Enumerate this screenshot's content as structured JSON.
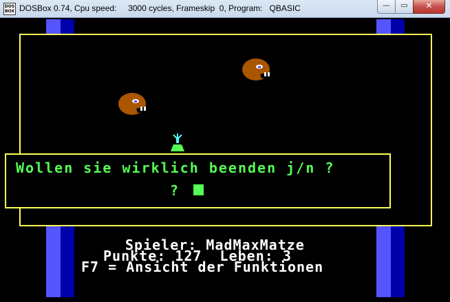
{
  "window": {
    "icon_text": "DOS BOX",
    "title": "DOSBox 0.74, Cpu speed:     3000 cycles, Frameskip  0, Program:   QBASIC",
    "minimize_glyph": "—",
    "maximize_glyph": "▭",
    "close_glyph": "✕"
  },
  "dialog": {
    "question": "Wollen sie wirklich beenden j/n ?",
    "prompt": "?"
  },
  "status": {
    "player_line": "Spieler: MadMaxMatze",
    "score_line": "Punkte: 127  Leben: 3",
    "help_line": "F7 = Ansicht der Funktionen"
  },
  "colors": {
    "frame_yellow": "#ffff55",
    "dialog_green": "#55ff55",
    "stripe_light": "#5555ff",
    "stripe_dark": "#0000aa",
    "creature_brown": "#aa5500",
    "player_green": "#55ff55"
  },
  "icons": {
    "creatures": [
      "brown-chomper-icon",
      "brown-chomper-icon"
    ],
    "player": "green-cannon-icon"
  }
}
